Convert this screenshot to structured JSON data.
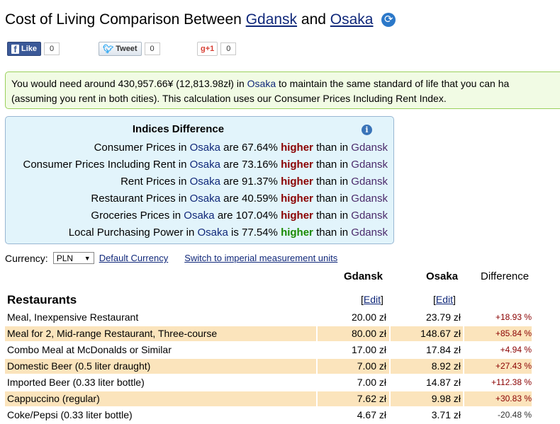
{
  "header": {
    "title_prefix": "Cost of Living Comparison Between",
    "city_a": "Gdansk",
    "and": "and",
    "city_b": "Osaka",
    "refresh_icon": "refresh-icon"
  },
  "social": {
    "like_label": "Like",
    "like_count": "0",
    "tweet_label": "Tweet",
    "tweet_count": "0",
    "gplus_label": "g+1",
    "gplus_count": "0"
  },
  "summary": {
    "part1": "You would need around 430,957.66¥ (12,813.98zł) in",
    "city": "Osaka",
    "part2": "to maintain the same standard of life that you can ha",
    "line2": "(assuming you rent in both cities). This calculation uses our Consumer Prices Including Rent Index."
  },
  "indices": {
    "title": "Indices Difference",
    "info_icon": "info-icon",
    "rows": [
      {
        "label": "Consumer Prices in",
        "city_a": "Osaka",
        "mid": "are 67.64%",
        "word": "higher",
        "than": "than in",
        "city_b": "Gdansk"
      },
      {
        "label": "Consumer Prices Including Rent in",
        "city_a": "Osaka",
        "mid": "are 73.16%",
        "word": "higher",
        "than": "than in",
        "city_b": "Gdansk"
      },
      {
        "label": "Rent Prices in",
        "city_a": "Osaka",
        "mid": "are 91.37%",
        "word": "higher",
        "than": "than in",
        "city_b": "Gdansk"
      },
      {
        "label": "Restaurant Prices in",
        "city_a": "Osaka",
        "mid": "are 40.59%",
        "word": "higher",
        "than": "than in",
        "city_b": "Gdansk"
      },
      {
        "label": "Groceries Prices in",
        "city_a": "Osaka",
        "mid": "are 107.04%",
        "word": "higher",
        "than": "than in",
        "city_b": "Gdansk"
      },
      {
        "label": "Local Purchasing Power in",
        "city_a": "Osaka",
        "mid": "is 77.54%",
        "word": "higher",
        "than": "than in",
        "city_b": "Gdansk"
      }
    ]
  },
  "currency": {
    "label": "Currency:",
    "selected": "PLN",
    "default_link": "Default Currency",
    "imperial_link": "Switch to imperial measurement units"
  },
  "table": {
    "col_a": "Gdansk",
    "col_b": "Osaka",
    "col_diff": "Difference",
    "section": "Restaurants",
    "edit_label": "Edit",
    "rows": [
      {
        "name": "Meal, Inexpensive Restaurant",
        "a": "20.00 zł",
        "b": "23.79 zł",
        "diff": "+18.93 %"
      },
      {
        "name": "Meal for 2, Mid-range Restaurant, Three-course",
        "a": "80.00 zł",
        "b": "148.67 zł",
        "diff": "+85.84 %"
      },
      {
        "name": "Combo Meal at McDonalds or Similar",
        "a": "17.00 zł",
        "b": "17.84 zł",
        "diff": "+4.94 %"
      },
      {
        "name": "Domestic Beer (0.5 liter draught)",
        "a": "7.00 zł",
        "b": "8.92 zł",
        "diff": "+27.43 %"
      },
      {
        "name": "Imported Beer (0.33 liter bottle)",
        "a": "7.00 zł",
        "b": "14.87 zł",
        "diff": "+112.38 %"
      },
      {
        "name": "Cappuccino (regular)",
        "a": "7.62 zł",
        "b": "9.98 zł",
        "diff": "+30.83 %"
      },
      {
        "name": "Coke/Pepsi (0.33 liter bottle)",
        "a": "4.67 zł",
        "b": "3.71 zł",
        "diff": "-20.48 %"
      }
    ]
  }
}
